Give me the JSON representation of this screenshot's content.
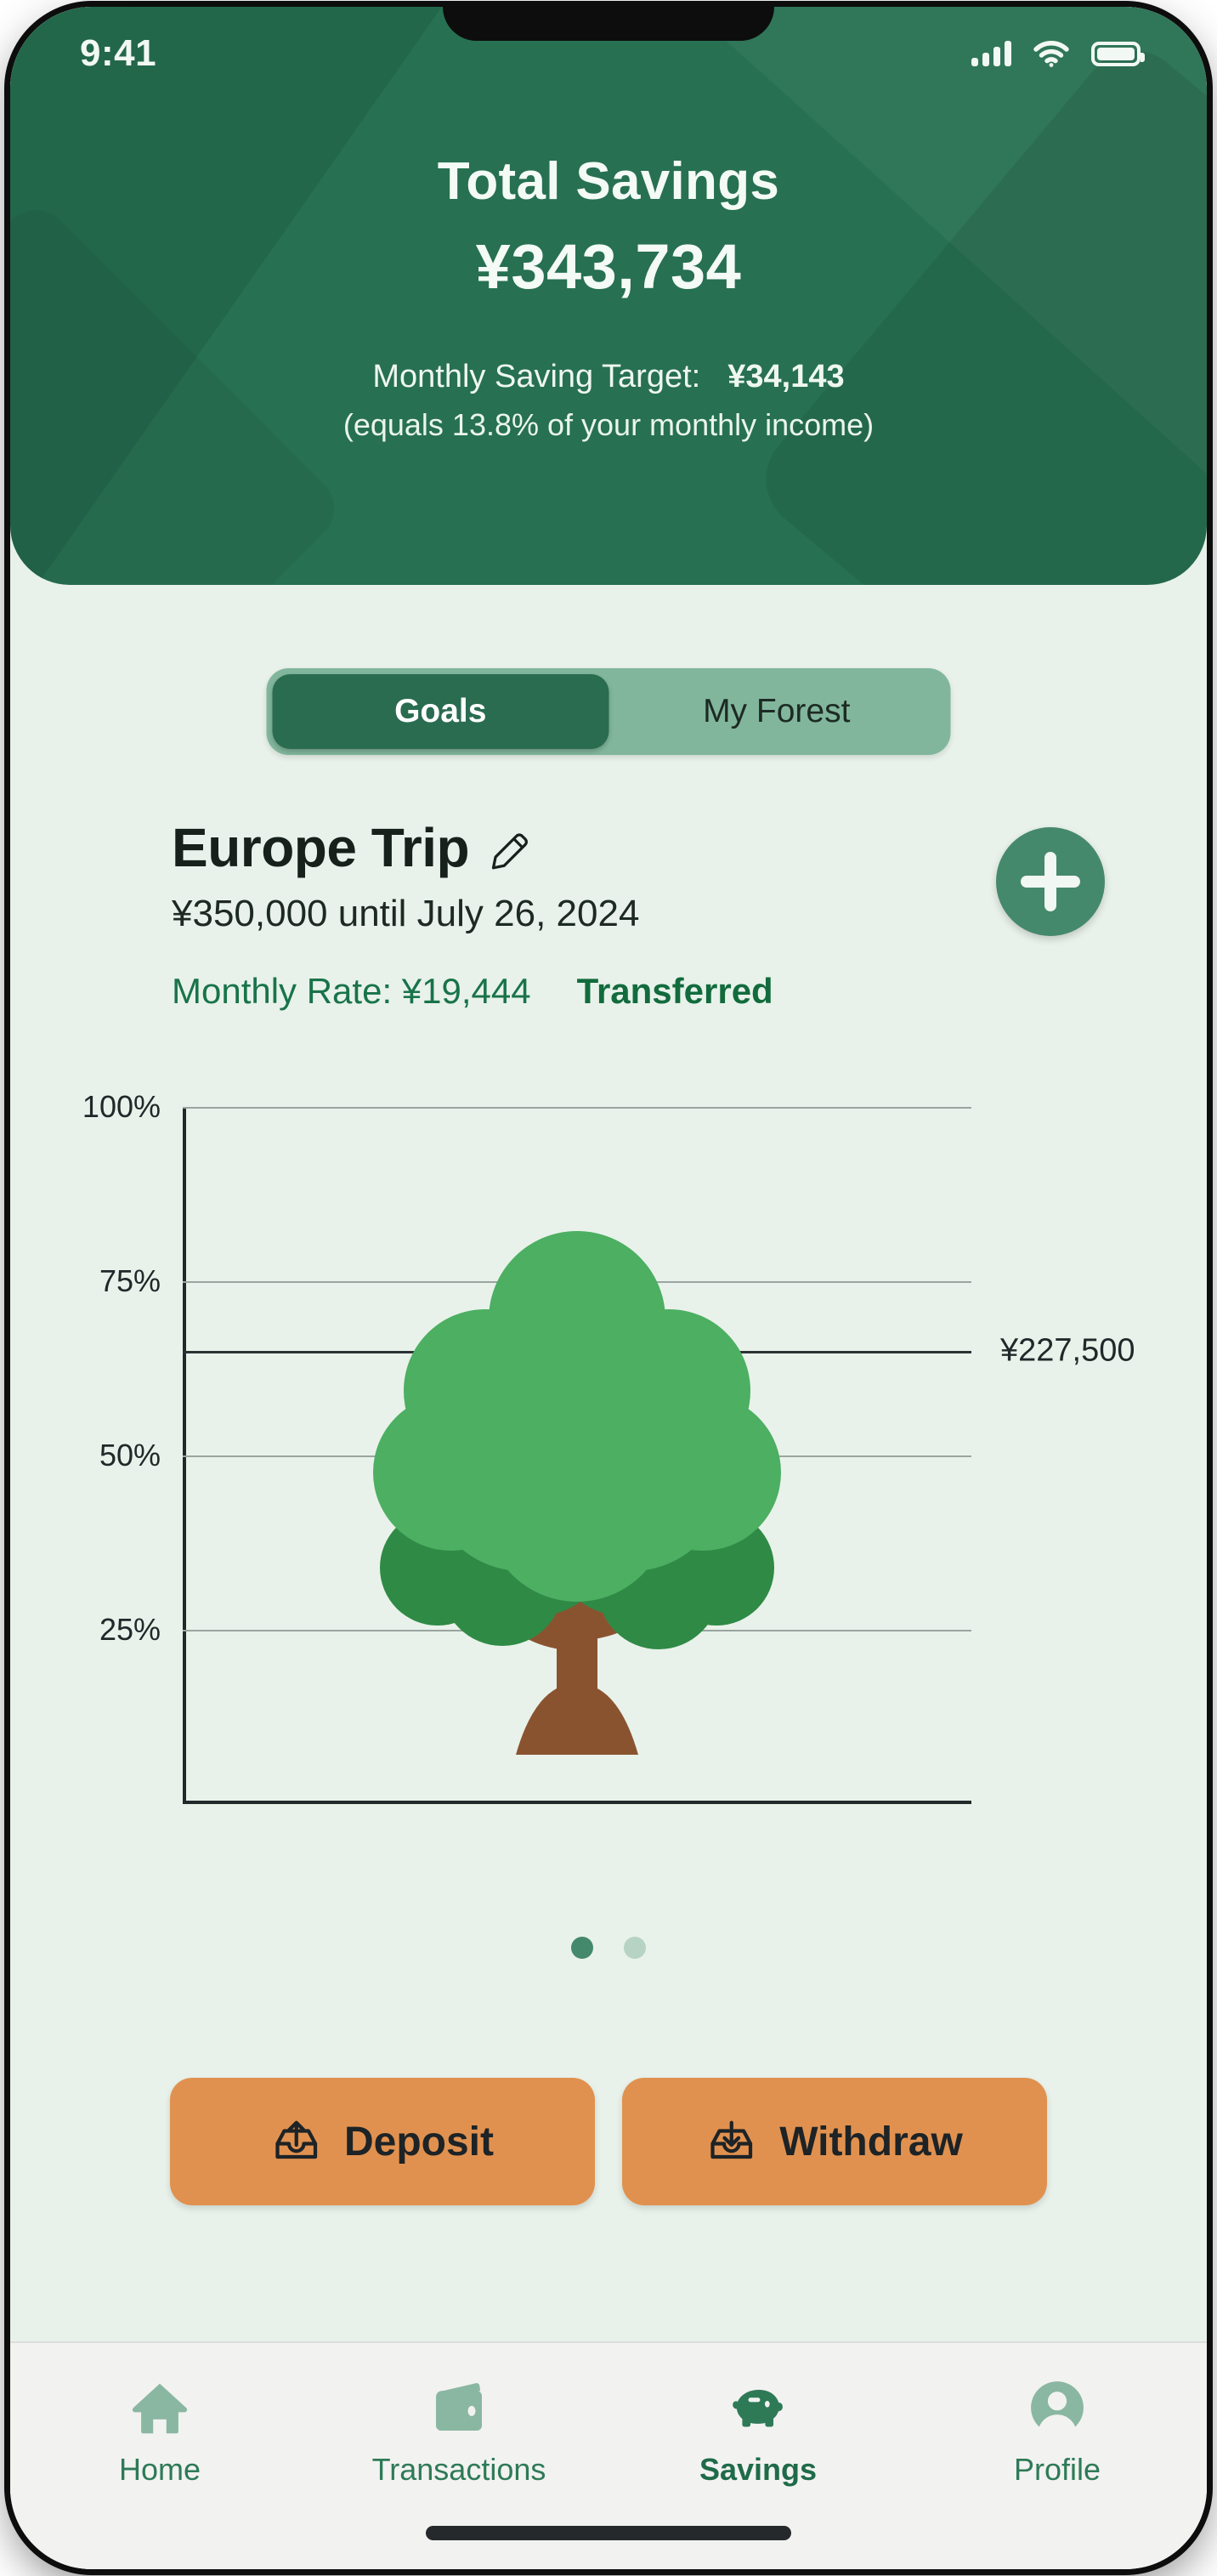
{
  "status_bar": {
    "time": "9:41",
    "signal_icon": "signal-bars-icon",
    "wifi_icon": "wifi-icon",
    "battery_icon": "battery-icon"
  },
  "header": {
    "total_label": "Total Savings",
    "total_amount": "¥343,734",
    "target_label": "Monthly Saving Target:",
    "target_value": "¥34,143",
    "target_note": "(equals 13.8% of your monthly income)",
    "bg_color": "#277052"
  },
  "segment": {
    "tabs": [
      {
        "label": "Goals",
        "active": true
      },
      {
        "label": "My Forest",
        "active": false
      }
    ],
    "active_color": "#2a6c50",
    "track_color": "#81b69c"
  },
  "goal": {
    "title": "Europe Trip",
    "edit_icon": "pencil-icon",
    "subtitle": "¥350,000 until July 26, 2024",
    "monthly_rate": "Monthly Rate: ¥19,444",
    "status": "Transferred",
    "status_color": "#126b3d",
    "add_button_icon": "plus-icon"
  },
  "chart_data": {
    "type": "bar",
    "title": "Europe Trip savings progress",
    "categories": [
      "Europe Trip"
    ],
    "values": [
      65
    ],
    "value_labels": [
      "¥227,500"
    ],
    "ylabel": "",
    "xlabel": "",
    "ylim": [
      0,
      100
    ],
    "yticks": [
      25,
      50,
      75,
      100
    ],
    "ytick_labels": [
      "25%",
      "50%",
      "75%",
      "100%"
    ],
    "grid": true,
    "legend": "none",
    "target_total": "¥350,000",
    "current_amount": "¥227,500",
    "current_percent": 65,
    "illustration": "tree-icon",
    "tree_colors": {
      "canopy_light": "#4caf62",
      "canopy_mid": "#45a55b",
      "canopy_dark": "#2f8a45",
      "trunk": "#8a5330"
    }
  },
  "pagination": {
    "dots": [
      {
        "active": true
      },
      {
        "active": false
      }
    ],
    "active_color": "#45896c",
    "inactive_color": "#b7d3c4"
  },
  "actions": {
    "buttons": [
      {
        "label": "Deposit",
        "icon": "upload-tray-icon"
      },
      {
        "label": "Withdraw",
        "icon": "download-tray-icon"
      }
    ],
    "color": "#e1914f"
  },
  "bottom_nav": {
    "items": [
      {
        "label": "Home",
        "icon": "home-icon",
        "active": false
      },
      {
        "label": "Transactions",
        "icon": "wallet-icon",
        "active": false
      },
      {
        "label": "Savings",
        "icon": "piggy-bank-icon",
        "active": true
      },
      {
        "label": "Profile",
        "icon": "person-icon",
        "active": false
      }
    ],
    "active_color": "#1f6b49",
    "inactive_color": "#8ab7a1"
  }
}
